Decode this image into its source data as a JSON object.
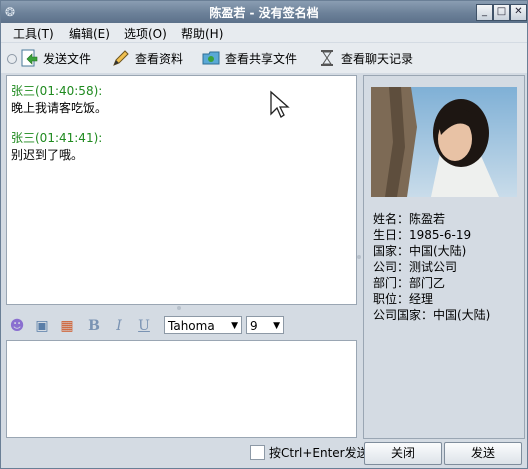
{
  "window": {
    "title": "陈盈若 - 没有签名档",
    "icon": "qq-penguin-icon",
    "controls": {
      "minimize": "_",
      "maximize": "□",
      "close": "✕"
    }
  },
  "menu": [
    "工具(T)",
    "编辑(E)",
    "选项(O)",
    "帮助(H)"
  ],
  "toolbar": [
    {
      "label": "发送文件",
      "icon": "send-file-icon"
    },
    {
      "label": "查看资料",
      "icon": "pencil-icon"
    },
    {
      "label": "查看共享文件",
      "icon": "share-folder-icon"
    },
    {
      "label": "查看聊天记录",
      "icon": "hourglass-icon"
    }
  ],
  "messages": [
    {
      "sender": "张三(01:40:58):",
      "text": "晚上我请客吃饭。"
    },
    {
      "sender": "张三(01:41:41):",
      "text": "别迟到了哦。"
    }
  ],
  "format": {
    "font": "Tahoma",
    "size": "9"
  },
  "profile": {
    "lines": [
      "姓名：陈盈若",
      "生日：1985-6-19",
      "国家：中国(大陆)",
      "公司：测试公司",
      "部门：部门乙",
      "职位：经理",
      "公司国家：中国(大陆)"
    ]
  },
  "bottom": {
    "checkbox_label": "按Ctrl+Enter发送",
    "close_label": "关闭",
    "send_label": "发送"
  },
  "colors": {
    "title_bar": "#6c8199",
    "sender": "#1f8a1f",
    "panel": "#d4dbe3"
  }
}
